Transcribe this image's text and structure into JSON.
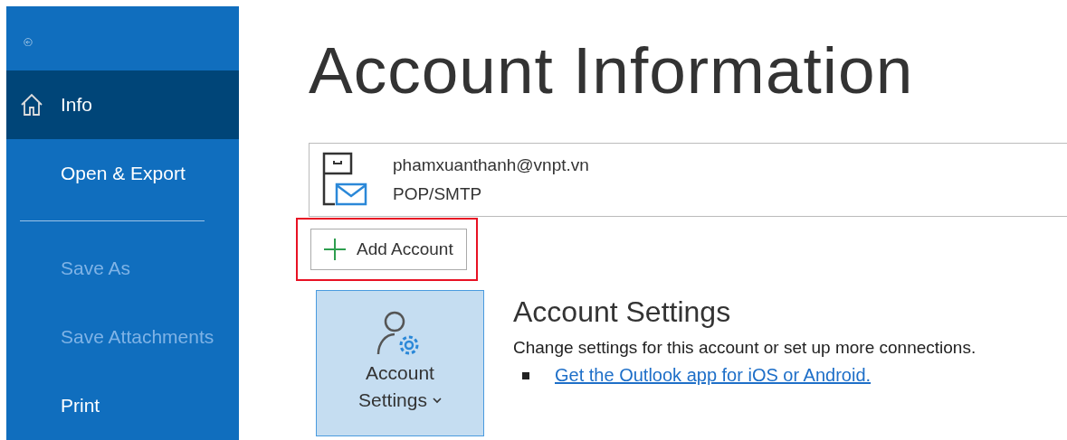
{
  "sidebar": {
    "items": [
      {
        "label": "Info",
        "selected": true,
        "disabled": false
      },
      {
        "label": "Open & Export",
        "selected": false,
        "disabled": false
      },
      {
        "kind": "divider"
      },
      {
        "label": "Save As",
        "selected": false,
        "disabled": true
      },
      {
        "label": "Save Attachments",
        "selected": false,
        "disabled": true
      },
      {
        "label": "Print",
        "selected": false,
        "disabled": false
      }
    ]
  },
  "title": "Account Information",
  "account": {
    "email": "phamxuanthanh@vnpt.vn",
    "type": "POP/SMTP"
  },
  "add_account": {
    "label": "Add Account",
    "highlighted": true
  },
  "account_settings": {
    "button_lines": [
      "Account",
      "Settings"
    ],
    "heading": "Account Settings",
    "description": "Change settings for this account or set up more connections.",
    "link": "Get the Outlook app for iOS or Android."
  }
}
